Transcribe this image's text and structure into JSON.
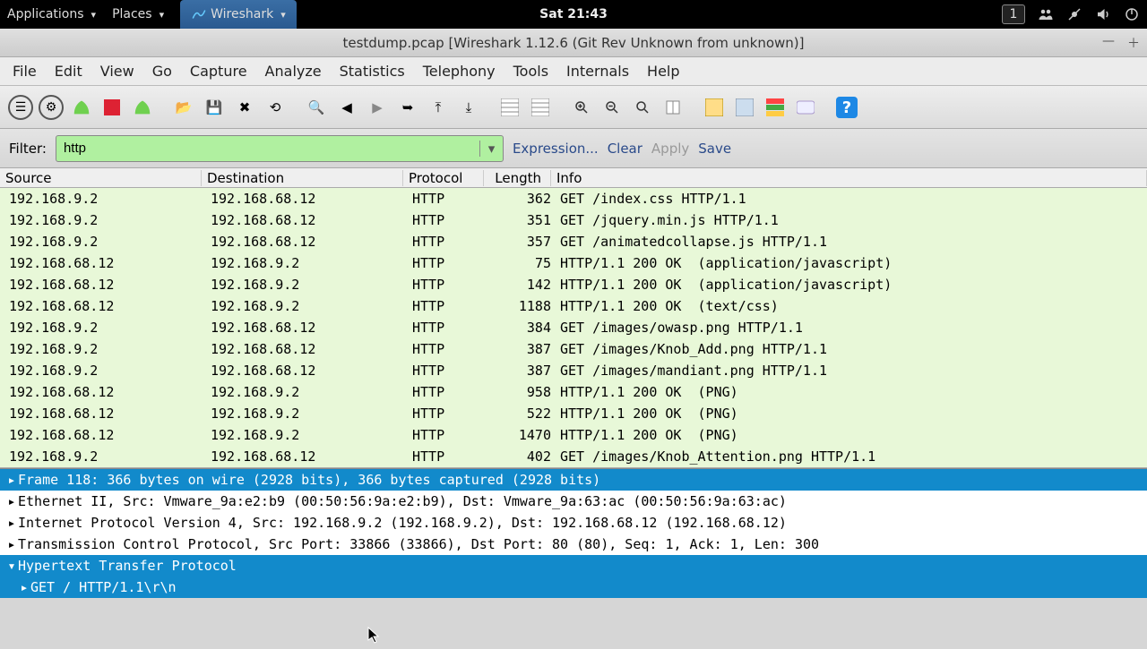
{
  "topbar": {
    "applications": "Applications",
    "places": "Places",
    "active_app": "Wireshark",
    "clock": "Sat 21:43",
    "workspace": "1"
  },
  "window": {
    "title": "testdump.pcap   [Wireshark 1.12.6  (Git Rev Unknown from unknown)]"
  },
  "menubar": {
    "file": "File",
    "edit": "Edit",
    "view": "View",
    "go": "Go",
    "capture": "Capture",
    "analyze": "Analyze",
    "statistics": "Statistics",
    "telephony": "Telephony",
    "tools": "Tools",
    "internals": "Internals",
    "help": "Help"
  },
  "filterbar": {
    "label": "Filter:",
    "value": "http",
    "expression": "Expression...",
    "clear": "Clear",
    "apply": "Apply",
    "save": "Save"
  },
  "columns": {
    "source": "Source",
    "destination": "Destination",
    "protocol": "Protocol",
    "length": "Length",
    "info": "Info"
  },
  "packets": [
    {
      "src": "192.168.9.2",
      "dst": "192.168.68.12",
      "proto": "HTTP",
      "len": "362",
      "info": "GET /index.css HTTP/1.1"
    },
    {
      "src": "192.168.9.2",
      "dst": "192.168.68.12",
      "proto": "HTTP",
      "len": "351",
      "info": "GET /jquery.min.js HTTP/1.1"
    },
    {
      "src": "192.168.9.2",
      "dst": "192.168.68.12",
      "proto": "HTTP",
      "len": "357",
      "info": "GET /animatedcollapse.js HTTP/1.1"
    },
    {
      "src": "192.168.68.12",
      "dst": "192.168.9.2",
      "proto": "HTTP",
      "len": "75",
      "info": "HTTP/1.1 200 OK  (application/javascript)"
    },
    {
      "src": "192.168.68.12",
      "dst": "192.168.9.2",
      "proto": "HTTP",
      "len": "142",
      "info": "HTTP/1.1 200 OK  (application/javascript)"
    },
    {
      "src": "192.168.68.12",
      "dst": "192.168.9.2",
      "proto": "HTTP",
      "len": "1188",
      "info": "HTTP/1.1 200 OK  (text/css)"
    },
    {
      "src": "192.168.9.2",
      "dst": "192.168.68.12",
      "proto": "HTTP",
      "len": "384",
      "info": "GET /images/owasp.png HTTP/1.1"
    },
    {
      "src": "192.168.9.2",
      "dst": "192.168.68.12",
      "proto": "HTTP",
      "len": "387",
      "info": "GET /images/Knob_Add.png HTTP/1.1"
    },
    {
      "src": "192.168.9.2",
      "dst": "192.168.68.12",
      "proto": "HTTP",
      "len": "387",
      "info": "GET /images/mandiant.png HTTP/1.1"
    },
    {
      "src": "192.168.68.12",
      "dst": "192.168.9.2",
      "proto": "HTTP",
      "len": "958",
      "info": "HTTP/1.1 200 OK  (PNG)"
    },
    {
      "src": "192.168.68.12",
      "dst": "192.168.9.2",
      "proto": "HTTP",
      "len": "522",
      "info": "HTTP/1.1 200 OK  (PNG)"
    },
    {
      "src": "192.168.68.12",
      "dst": "192.168.9.2",
      "proto": "HTTP",
      "len": "1470",
      "info": "HTTP/1.1 200 OK  (PNG)"
    },
    {
      "src": "192.168.9.2",
      "dst": "192.168.68.12",
      "proto": "HTTP",
      "len": "402",
      "info": "GET /images/Knob_Attention.png HTTP/1.1"
    }
  ],
  "details": {
    "frame": "Frame 118: 366 bytes on wire (2928 bits), 366 bytes captured (2928 bits)",
    "eth": "Ethernet II, Src: Vmware_9a:e2:b9 (00:50:56:9a:e2:b9), Dst: Vmware_9a:63:ac (00:50:56:9a:63:ac)",
    "ip": "Internet Protocol Version 4, Src: 192.168.9.2 (192.168.9.2), Dst: 192.168.68.12 (192.168.68.12)",
    "tcp": "Transmission Control Protocol, Src Port: 33866 (33866), Dst Port: 80 (80), Seq: 1, Ack: 1, Len: 300",
    "http": "Hypertext Transfer Protocol",
    "get": "GET / HTTP/1.1\\r\\n"
  }
}
